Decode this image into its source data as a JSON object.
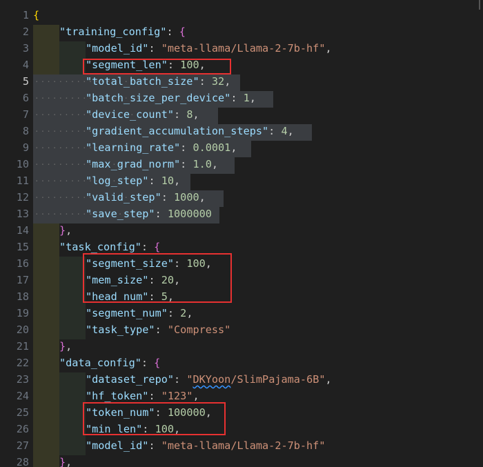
{
  "editor": {
    "lines": [
      {
        "num": "1",
        "indent": 0,
        "parts": [
          {
            "t": "{",
            "c": "b1"
          }
        ]
      },
      {
        "num": "2",
        "indent": 1,
        "parts": [
          {
            "t": "\"training_config\"",
            "c": "k"
          },
          {
            "t": ": ",
            "c": "p"
          },
          {
            "t": "{",
            "c": "b2"
          }
        ]
      },
      {
        "num": "3",
        "indent": 2,
        "parts": [
          {
            "t": "\"model_id\"",
            "c": "k"
          },
          {
            "t": ": ",
            "c": "p"
          },
          {
            "t": "\"meta-llama/Llama-2-7b-hf\"",
            "c": "s"
          },
          {
            "t": ",",
            "c": "p"
          }
        ]
      },
      {
        "num": "4",
        "indent": 2,
        "parts": [
          {
            "t": "\"segment_len\"",
            "c": "k"
          },
          {
            "t": ": ",
            "c": "p"
          },
          {
            "t": "100",
            "c": "n"
          },
          {
            "t": ",",
            "c": "p"
          }
        ]
      },
      {
        "num": "5",
        "indent": 2,
        "parts": [
          {
            "t": "\"total_batch_size\"",
            "c": "k"
          },
          {
            "t": ": ",
            "c": "p"
          },
          {
            "t": "32",
            "c": "n"
          },
          {
            "t": ",",
            "c": "p"
          }
        ]
      },
      {
        "num": "6",
        "indent": 2,
        "parts": [
          {
            "t": "\"batch_size_per_device\"",
            "c": "k"
          },
          {
            "t": ": ",
            "c": "p"
          },
          {
            "t": "1",
            "c": "n"
          },
          {
            "t": ",",
            "c": "p"
          }
        ]
      },
      {
        "num": "7",
        "indent": 2,
        "parts": [
          {
            "t": "\"device_count\"",
            "c": "k"
          },
          {
            "t": ": ",
            "c": "p"
          },
          {
            "t": "8",
            "c": "n"
          },
          {
            "t": ",",
            "c": "p"
          }
        ]
      },
      {
        "num": "8",
        "indent": 2,
        "parts": [
          {
            "t": "\"gradient_accumulation_steps\"",
            "c": "k"
          },
          {
            "t": ": ",
            "c": "p"
          },
          {
            "t": "4",
            "c": "n"
          },
          {
            "t": ",",
            "c": "p"
          }
        ]
      },
      {
        "num": "9",
        "indent": 2,
        "parts": [
          {
            "t": "\"learning_rate\"",
            "c": "k"
          },
          {
            "t": ": ",
            "c": "p"
          },
          {
            "t": "0.0001",
            "c": "n"
          },
          {
            "t": ",",
            "c": "p"
          }
        ]
      },
      {
        "num": "10",
        "indent": 2,
        "parts": [
          {
            "t": "\"max_grad_norm\"",
            "c": "k"
          },
          {
            "t": ": ",
            "c": "p"
          },
          {
            "t": "1.0",
            "c": "n"
          },
          {
            "t": ",",
            "c": "p"
          }
        ]
      },
      {
        "num": "11",
        "indent": 2,
        "parts": [
          {
            "t": "\"log_step\"",
            "c": "k"
          },
          {
            "t": ": ",
            "c": "p"
          },
          {
            "t": "10",
            "c": "n"
          },
          {
            "t": ",",
            "c": "p"
          }
        ]
      },
      {
        "num": "12",
        "indent": 2,
        "parts": [
          {
            "t": "\"valid_step\"",
            "c": "k"
          },
          {
            "t": ": ",
            "c": "p"
          },
          {
            "t": "1000",
            "c": "n"
          },
          {
            "t": ",",
            "c": "p"
          }
        ]
      },
      {
        "num": "13",
        "indent": 2,
        "parts": [
          {
            "t": "\"save_step\"",
            "c": "k"
          },
          {
            "t": ": ",
            "c": "p"
          },
          {
            "t": "1000000",
            "c": "n"
          }
        ]
      },
      {
        "num": "14",
        "indent": 1,
        "parts": [
          {
            "t": "}",
            "c": "b2"
          },
          {
            "t": ",",
            "c": "p"
          }
        ]
      },
      {
        "num": "15",
        "indent": 1,
        "parts": [
          {
            "t": "\"task_config\"",
            "c": "k"
          },
          {
            "t": ": ",
            "c": "p"
          },
          {
            "t": "{",
            "c": "b2"
          }
        ]
      },
      {
        "num": "16",
        "indent": 2,
        "parts": [
          {
            "t": "\"segment_size\"",
            "c": "k"
          },
          {
            "t": ": ",
            "c": "p"
          },
          {
            "t": "100",
            "c": "n"
          },
          {
            "t": ",",
            "c": "p"
          }
        ]
      },
      {
        "num": "17",
        "indent": 2,
        "parts": [
          {
            "t": "\"mem_size\"",
            "c": "k"
          },
          {
            "t": ": ",
            "c": "p"
          },
          {
            "t": "20",
            "c": "n"
          },
          {
            "t": ",",
            "c": "p"
          }
        ]
      },
      {
        "num": "18",
        "indent": 2,
        "parts": [
          {
            "t": "\"head_num\"",
            "c": "k"
          },
          {
            "t": ": ",
            "c": "p"
          },
          {
            "t": "5",
            "c": "n"
          },
          {
            "t": ",",
            "c": "p"
          }
        ]
      },
      {
        "num": "19",
        "indent": 2,
        "parts": [
          {
            "t": "\"segment_num\"",
            "c": "k"
          },
          {
            "t": ": ",
            "c": "p"
          },
          {
            "t": "2",
            "c": "n"
          },
          {
            "t": ",",
            "c": "p"
          }
        ]
      },
      {
        "num": "20",
        "indent": 2,
        "parts": [
          {
            "t": "\"task_type\"",
            "c": "k"
          },
          {
            "t": ": ",
            "c": "p"
          },
          {
            "t": "\"Compress\"",
            "c": "s"
          }
        ]
      },
      {
        "num": "21",
        "indent": 1,
        "parts": [
          {
            "t": "}",
            "c": "b2"
          },
          {
            "t": ",",
            "c": "p"
          }
        ]
      },
      {
        "num": "22",
        "indent": 1,
        "parts": [
          {
            "t": "\"data_config\"",
            "c": "k"
          },
          {
            "t": ": ",
            "c": "p"
          },
          {
            "t": "{",
            "c": "b2"
          }
        ]
      },
      {
        "num": "23",
        "indent": 2,
        "parts": [
          {
            "t": "\"dataset_repo\"",
            "c": "k"
          },
          {
            "t": ": ",
            "c": "p"
          },
          {
            "t": "\"",
            "c": "s"
          },
          {
            "t": "DKYoon",
            "c": "s squig"
          },
          {
            "t": "/SlimPajama-6B\"",
            "c": "s"
          },
          {
            "t": ",",
            "c": "p"
          }
        ]
      },
      {
        "num": "24",
        "indent": 2,
        "parts": [
          {
            "t": "\"hf_token\"",
            "c": "k"
          },
          {
            "t": ": ",
            "c": "p"
          },
          {
            "t": "\"123\"",
            "c": "s"
          },
          {
            "t": ",",
            "c": "p"
          }
        ]
      },
      {
        "num": "25",
        "indent": 2,
        "parts": [
          {
            "t": "\"token_num\"",
            "c": "k"
          },
          {
            "t": ": ",
            "c": "p"
          },
          {
            "t": "100000",
            "c": "n"
          },
          {
            "t": ",",
            "c": "p"
          }
        ]
      },
      {
        "num": "26",
        "indent": 2,
        "parts": [
          {
            "t": "\"min_len\"",
            "c": "k"
          },
          {
            "t": ": ",
            "c": "p"
          },
          {
            "t": "100",
            "c": "n"
          },
          {
            "t": ",",
            "c": "p"
          }
        ]
      },
      {
        "num": "27",
        "indent": 2,
        "parts": [
          {
            "t": "\"model_id\"",
            "c": "k"
          },
          {
            "t": ": ",
            "c": "p"
          },
          {
            "t": "\"meta-llama/Llama-2-7b-hf\"",
            "c": "s"
          }
        ]
      },
      {
        "num": "28",
        "indent": 1,
        "parts": [
          {
            "t": "}",
            "c": "b2"
          },
          {
            "t": ",",
            "c": "p"
          }
        ]
      }
    ],
    "active_line": "5",
    "highlighted_keys": [
      "segment_len",
      "segment_size",
      "mem_size",
      "head_num",
      "token_num",
      "min_len"
    ],
    "colors": {
      "background": "#1f1f1f",
      "key": "#9cdcfe",
      "string": "#ce9178",
      "number": "#b5cea8",
      "bracket_outer": "#ffd700",
      "bracket_inner": "#da70d6",
      "highlight_box": "#e83131"
    }
  }
}
